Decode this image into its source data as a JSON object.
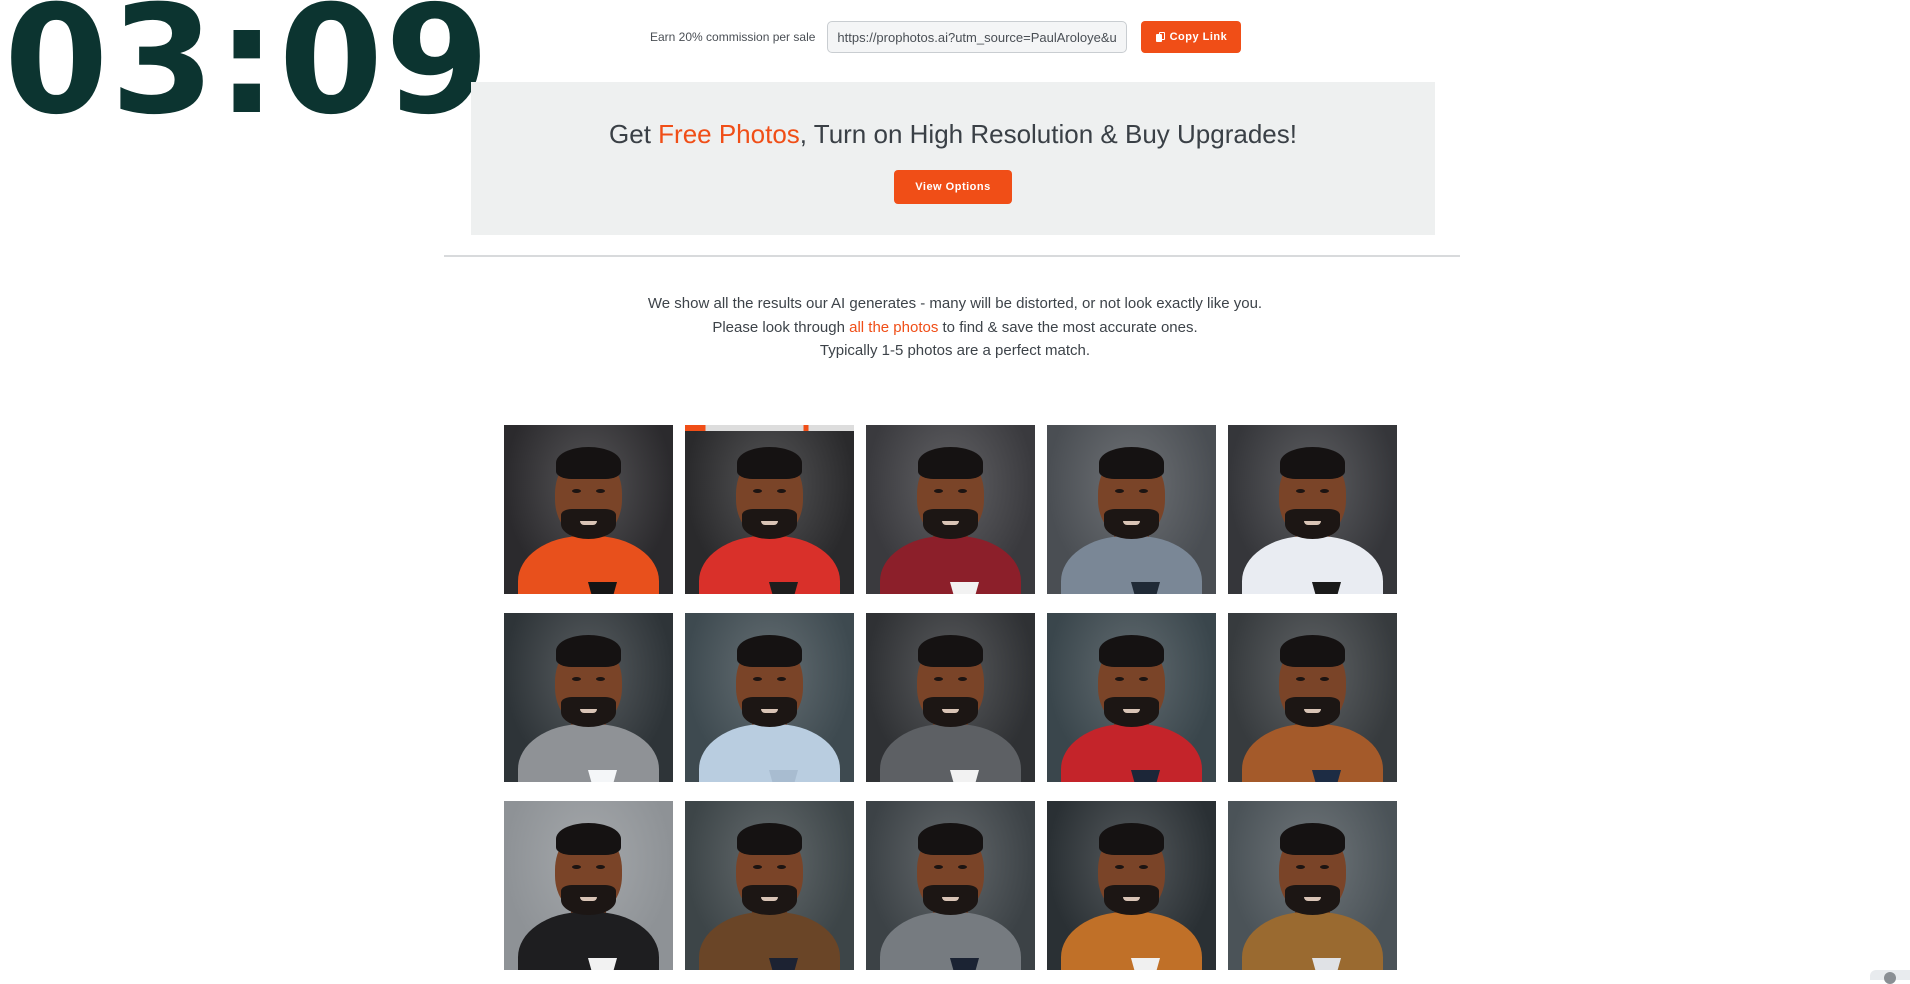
{
  "overlay": {
    "timer": "03:09"
  },
  "referral": {
    "label": "Earn 20% commission per sale",
    "link_value": "https://prophotos.ai?utm_source=PaulAroloye&u",
    "copy_label": "Copy Link"
  },
  "banner": {
    "title_prefix": "Get ",
    "title_highlight": "Free Photos",
    "title_suffix": ", Turn on High Resolution & Buy Upgrades!",
    "button_label": "View Options"
  },
  "notice": {
    "line1": "We show all the results our AI generates - many will be distorted, or not look exactly like you.",
    "line2_prefix": "Please look through ",
    "line2_link": "all the photos",
    "line2_suffix": " to find & save the most accurate ones.",
    "line3": "Typically 1-5 photos are a perfect match."
  },
  "photos": [
    {
      "bg": "#2b2a2d",
      "outfit": "#e8501c",
      "collar": "#141414",
      "selected": false
    },
    {
      "bg": "#2a2a2c",
      "outfit": "#d9302a",
      "collar": "#1d1d1d",
      "selected": true
    },
    {
      "bg": "#3a3a3e",
      "outfit": "#8c1f2a",
      "collar": "#f2f2f2",
      "selected": false
    },
    {
      "bg": "#4a4e53",
      "outfit": "#7a8796",
      "collar": "#202a36",
      "selected": false
    },
    {
      "bg": "#35363a",
      "outfit": "#e9ecf2",
      "collar": "#1a1a1a",
      "selected": false
    },
    {
      "bg": "#2e3438",
      "outfit": "#8f9296",
      "collar": "#f4f6f8",
      "selected": false
    },
    {
      "bg": "#3e4a50",
      "outfit": "#b9cde0",
      "collar": "#a8bcd0",
      "selected": false
    },
    {
      "bg": "#2f3134",
      "outfit": "#5d6064",
      "collar": "#f2f2f2",
      "selected": false
    },
    {
      "bg": "#3a464c",
      "outfit": "#c4242a",
      "collar": "#1c2638",
      "selected": false
    },
    {
      "bg": "#373b3e",
      "outfit": "#a45a2a",
      "collar": "#1d2c44",
      "selected": false
    },
    {
      "bg": "#8e9296",
      "outfit": "#1e1e20",
      "collar": "#f2f2f2",
      "selected": false
    },
    {
      "bg": "#3d4548",
      "outfit": "#6a4527",
      "collar": "#1c2232",
      "selected": false
    },
    {
      "bg": "#3c4246",
      "outfit": "#767b80",
      "collar": "#1b2333",
      "selected": false
    },
    {
      "bg": "#2a3034",
      "outfit": "#c07028",
      "collar": "#f0f0f0",
      "selected": false
    },
    {
      "bg": "#4b5358",
      "outfit": "#9a6a30",
      "collar": "#e0e2e6",
      "selected": false
    }
  ]
}
